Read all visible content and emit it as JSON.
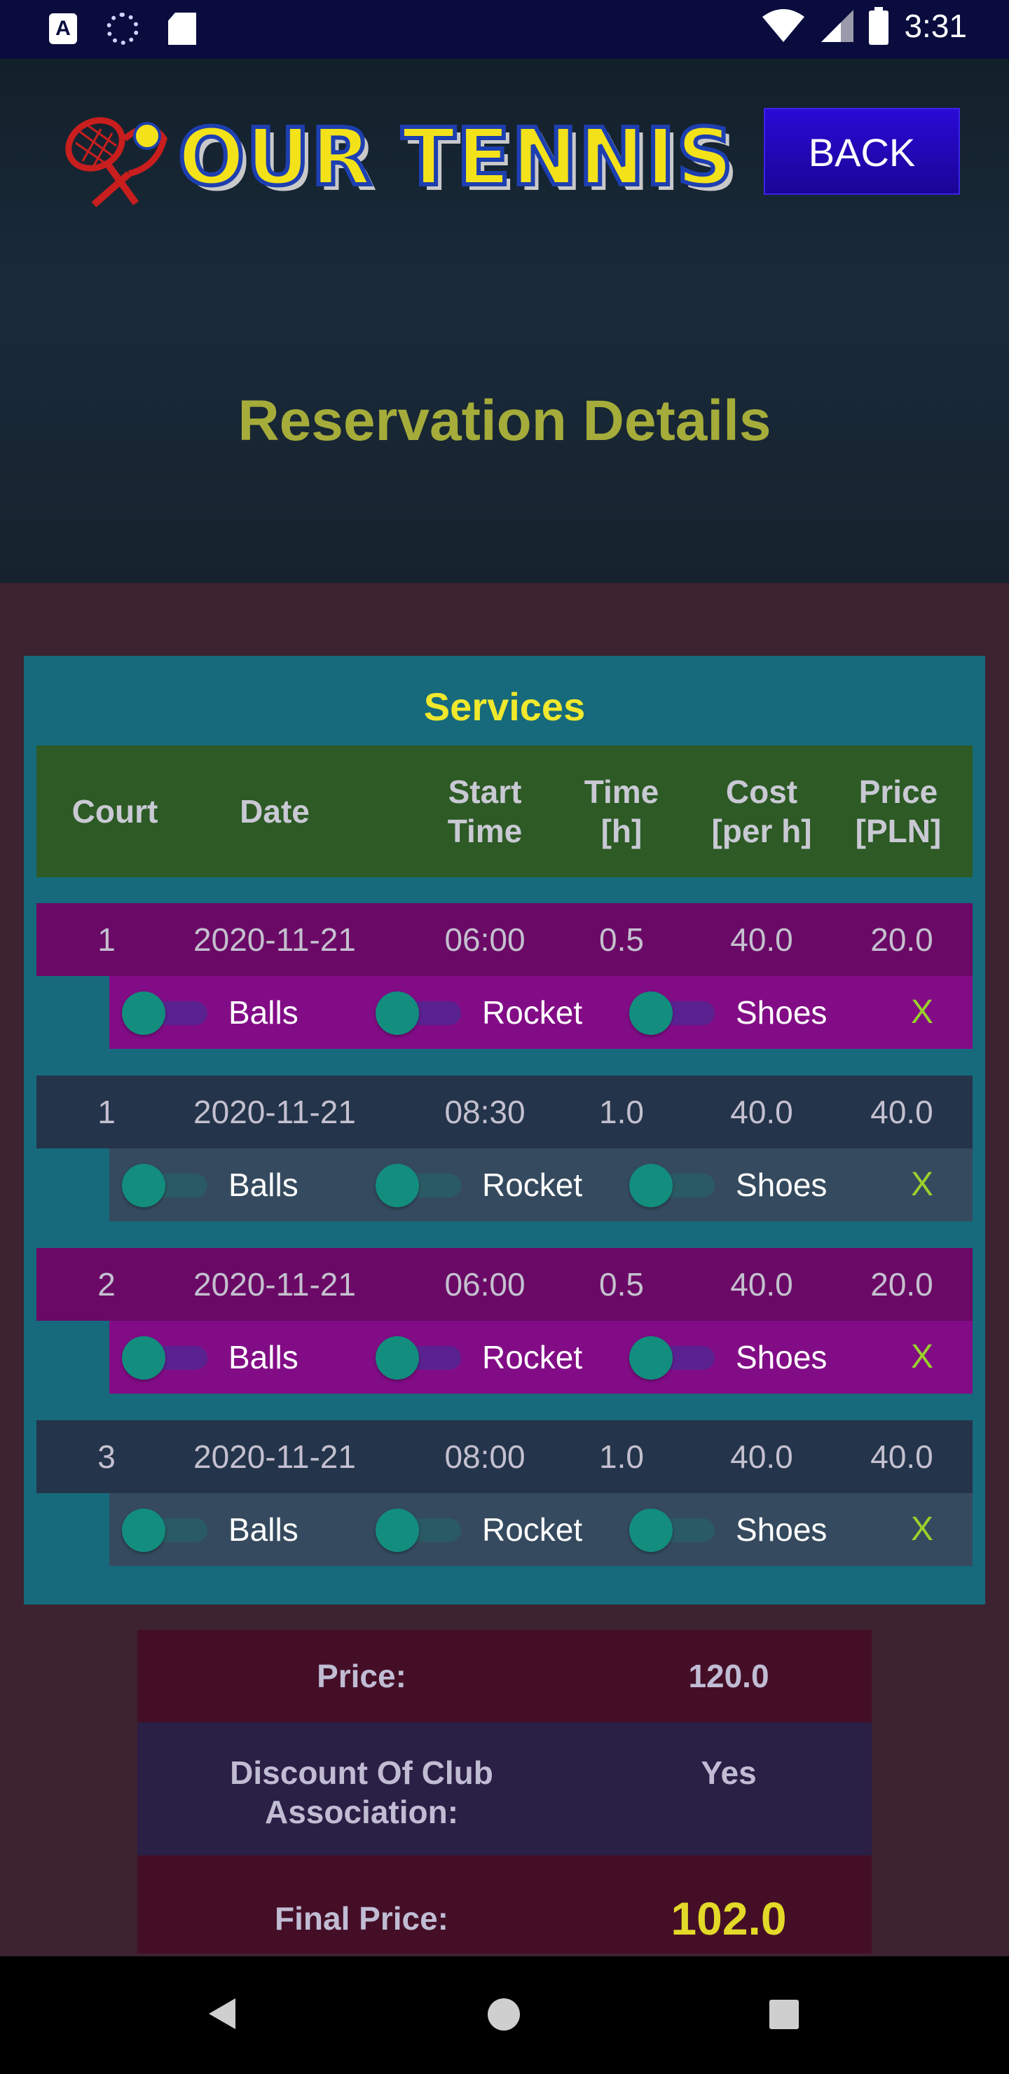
{
  "status_bar": {
    "time": "3:31",
    "icons": [
      "accessibility-a-icon",
      "loading-icon",
      "sd-card-icon",
      "wifi-icon",
      "signal-icon",
      "battery-icon"
    ]
  },
  "header": {
    "logo_text": "OUR TENNIS",
    "back_label": "BACK",
    "title": "Reservation Details"
  },
  "services": {
    "title": "Services",
    "columns": [
      "Court",
      "Date",
      "Start\nTime",
      "Time\n[h]",
      "Cost\n[per h]",
      "Price\n[PLN]"
    ],
    "rows": [
      {
        "court": "1",
        "date": "2020-11-21",
        "start": "06:00",
        "time": "0.5",
        "cost": "40.0",
        "price": "20.0",
        "balls": "Balls",
        "rocket": "Rocket",
        "shoes": "Shoes",
        "remove": "X"
      },
      {
        "court": "1",
        "date": "2020-11-21",
        "start": "08:30",
        "time": "1.0",
        "cost": "40.0",
        "price": "40.0",
        "balls": "Balls",
        "rocket": "Rocket",
        "shoes": "Shoes",
        "remove": "X"
      },
      {
        "court": "2",
        "date": "2020-11-21",
        "start": "06:00",
        "time": "0.5",
        "cost": "40.0",
        "price": "20.0",
        "balls": "Balls",
        "rocket": "Rocket",
        "shoes": "Shoes",
        "remove": "X"
      },
      {
        "court": "3",
        "date": "2020-11-21",
        "start": "08:00",
        "time": "1.0",
        "cost": "40.0",
        "price": "40.0",
        "balls": "Balls",
        "rocket": "Rocket",
        "shoes": "Shoes",
        "remove": "X"
      }
    ]
  },
  "summary": {
    "price_label": "Price:",
    "price_value": "120.0",
    "discount_label": "Discount Of Club\nAssociation:",
    "discount_value": "Yes",
    "final_label": "Final Price:",
    "final_value": "102.0"
  },
  "nav": {
    "icons": [
      "back-icon",
      "home-icon",
      "recents-icon"
    ]
  },
  "colors": {
    "accent_title": "#a5ac3a",
    "services_title": "#f0e82c",
    "final_price": "#e3d928",
    "remove_x": "#9ad12c",
    "back_button": "#1a0596"
  }
}
